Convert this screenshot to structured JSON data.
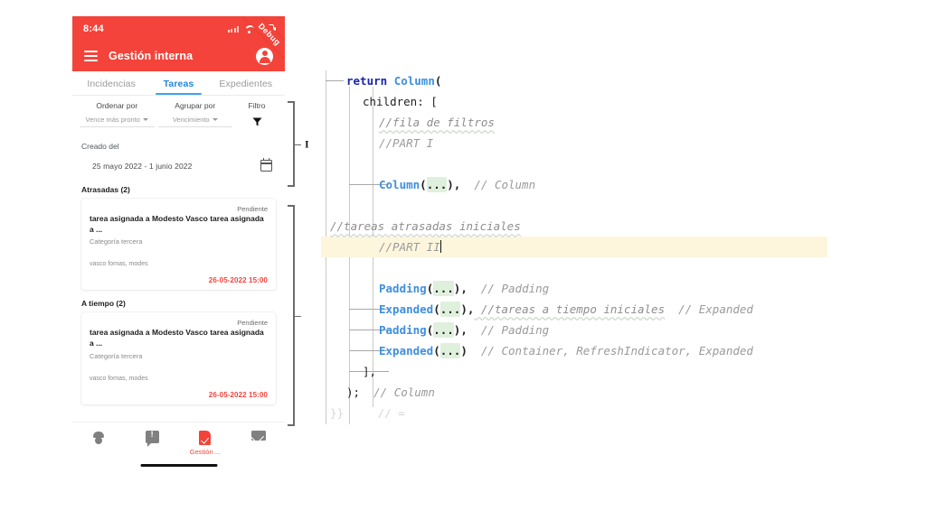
{
  "phone": {
    "status_bar": {
      "clock": "8:44",
      "wifi_icon": "wifi-icon",
      "battery_icon": "battery-icon",
      "signal_icon": "signal-dots-icon"
    },
    "debug_ribbon_label": "Debug",
    "app_bar": {
      "menu_icon": "hamburger-menu-icon",
      "title": "Gestión interna",
      "account_icon": "account-circle-icon"
    },
    "tabs": [
      {
        "label": "Incidencias",
        "active": false
      },
      {
        "label": "Tareas",
        "active": true
      },
      {
        "label": "Expedientes",
        "active": false
      }
    ],
    "filters": {
      "sort": {
        "label": "Ordenar por",
        "value": "Vence más pronto"
      },
      "group": {
        "label": "Agrupar por",
        "value": "Vencimiento"
      },
      "filter": {
        "label": "Filtro",
        "icon": "funnel-filter-icon"
      }
    },
    "date_filter": {
      "label": "Creado del",
      "range": "25  mayo 2022 -  1 junio 2022",
      "calendar_icon": "calendar-icon"
    },
    "groups": [
      {
        "heading": "Atrasadas (2)",
        "cards": [
          {
            "status": "Pendiente",
            "title": "tarea asignada a Modesto Vasco tarea asignada a ...",
            "category": "Categoría tercera",
            "people": "vasco fornas, modes",
            "date": "26-05-2022 15:00"
          }
        ]
      },
      {
        "heading": "A tiempo (2)",
        "cards": [
          {
            "status": "Pendiente",
            "title": "tarea asignada a Modesto Vasco tarea asignada a ...",
            "category": "Categoría tercera",
            "people": "vasco fornas, modes",
            "date": "26-05-2022 15:00"
          }
        ]
      }
    ],
    "bottom_nav": [
      {
        "icon": "veterinary-paw-icon",
        "label": ""
      },
      {
        "icon": "alert-chat-icon",
        "label": ""
      },
      {
        "icon": "document-check-icon",
        "label": "Gestión ..."
      },
      {
        "icon": "mail-envelope-icon",
        "label": ""
      }
    ],
    "home_indicator": "home-indicator"
  },
  "annotations": [
    {
      "label": "I"
    },
    {
      "label": ""
    }
  ],
  "colors": {
    "brand_red": "#f4433a",
    "tab_blue": "#3fa2f0",
    "class_blue": "#3e8fe0",
    "keyword_blue": "#1a23a8",
    "comment_gray": "#9a9a9a",
    "fold_green": "#dff0dc",
    "cursor_line_yellow": "#fdf6dd"
  },
  "code": {
    "lines": [
      {
        "id": 1,
        "indent": 1,
        "tokens": [
          {
            "t": "kw",
            "v": "return"
          },
          {
            "t": "plain",
            "v": " "
          },
          {
            "t": "cls",
            "v": "Column"
          },
          {
            "t": "pun",
            "v": "("
          }
        ]
      },
      {
        "id": 2,
        "indent": 2,
        "tokens": [
          {
            "t": "plain",
            "v": "children: ["
          }
        ]
      },
      {
        "id": 3,
        "indent": 3,
        "tokens": [
          {
            "t": "cm-sp",
            "v": "//fila de filtros"
          }
        ]
      },
      {
        "id": 4,
        "indent": 3,
        "tokens": [
          {
            "t": "cm",
            "v": "//PART I"
          }
        ]
      },
      {
        "id": 5,
        "indent": 0,
        "tokens": []
      },
      {
        "id": 6,
        "indent": 3,
        "tokens": [
          {
            "t": "cls",
            "v": "Column"
          },
          {
            "t": "pun",
            "v": "("
          },
          {
            "t": "fold",
            "v": "..."
          },
          {
            "t": "pun",
            "v": "),"
          },
          {
            "t": "cm",
            "v": "  // Column"
          }
        ]
      },
      {
        "id": 7,
        "indent": 0,
        "tokens": []
      },
      {
        "id": 8,
        "indent": 0,
        "tokens": [
          {
            "t": "cm-sp",
            "v": "//tareas atrasadas iniciales"
          }
        ]
      },
      {
        "id": 9,
        "indent": 3,
        "tokens": [
          {
            "t": "cm",
            "v": "//PART II"
          },
          {
            "t": "caret",
            "v": ""
          }
        ],
        "highlight": true
      },
      {
        "id": 10,
        "indent": 0,
        "tokens": []
      },
      {
        "id": 11,
        "indent": 3,
        "tokens": [
          {
            "t": "cls",
            "v": "Padding"
          },
          {
            "t": "pun",
            "v": "("
          },
          {
            "t": "fold",
            "v": "..."
          },
          {
            "t": "pun",
            "v": "),"
          },
          {
            "t": "cm",
            "v": "  // Padding"
          }
        ]
      },
      {
        "id": 12,
        "indent": 3,
        "tokens": [
          {
            "t": "cls",
            "v": "Expanded"
          },
          {
            "t": "pun",
            "v": "("
          },
          {
            "t": "fold",
            "v": "..."
          },
          {
            "t": "pun",
            "v": "),"
          },
          {
            "t": "cm-sp",
            "v": " //tareas a tiempo iniciales"
          },
          {
            "t": "cm",
            "v": "  // Expanded"
          }
        ]
      },
      {
        "id": 13,
        "indent": 3,
        "tokens": [
          {
            "t": "cls",
            "v": "Padding"
          },
          {
            "t": "pun",
            "v": "("
          },
          {
            "t": "fold",
            "v": "..."
          },
          {
            "t": "pun",
            "v": "),"
          },
          {
            "t": "cm",
            "v": "  // Padding"
          }
        ]
      },
      {
        "id": 14,
        "indent": 3,
        "tokens": [
          {
            "t": "cls",
            "v": "Expanded"
          },
          {
            "t": "pun",
            "v": "("
          },
          {
            "t": "fold",
            "v": "..."
          },
          {
            "t": "pun",
            "v": ")"
          },
          {
            "t": "cm",
            "v": "  // Container, RefreshIndicator, Expanded"
          }
        ]
      },
      {
        "id": 15,
        "indent": 2,
        "tokens": [
          {
            "t": "plain",
            "v": "],"
          }
        ]
      },
      {
        "id": 16,
        "indent": 1,
        "tokens": [
          {
            "t": "plain",
            "v": ");"
          },
          {
            "t": "cm",
            "v": "  // Column"
          }
        ]
      },
      {
        "id": 17,
        "indent": 0,
        "tokens": [
          {
            "t": "plain",
            "v": "}}     // ="
          }
        ],
        "clipped": true
      }
    ]
  }
}
